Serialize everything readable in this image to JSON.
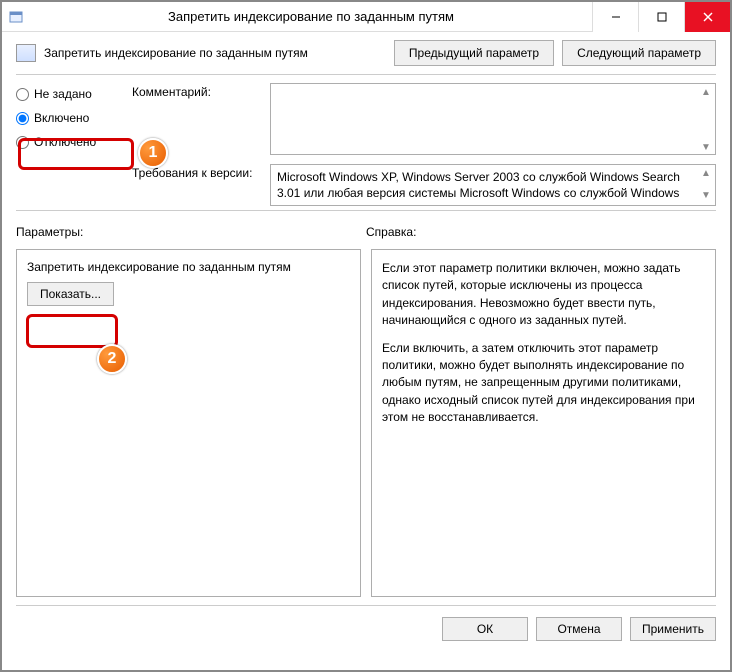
{
  "titlebar": {
    "title": "Запретить индексирование по заданным путям"
  },
  "header": {
    "title": "Запретить индексирование по заданным путям",
    "prev": "Предыдущий параметр",
    "next": "Следующий параметр"
  },
  "radios": {
    "not_configured": "Не задано",
    "enabled": "Включено",
    "disabled": "Отключено"
  },
  "comment": {
    "label": "Комментарий:",
    "value": ""
  },
  "requirements": {
    "label": "Требования к версии:",
    "text": "Microsoft Windows XP, Windows Server 2003 со службой Windows Search 3.01 или любая версия системы Microsoft Windows со службой Windows"
  },
  "sections": {
    "params": "Параметры:",
    "help": "Справка:"
  },
  "params": {
    "title": "Запретить индексирование по заданным путям",
    "show": "Показать..."
  },
  "help": {
    "p1": "Если этот параметр политики включен, можно задать список путей, которые исключены из процесса индексирования. Невозможно будет ввести путь, начинающийся с одного из заданных путей.",
    "p2": "Если включить, а затем отключить этот параметр политики, можно будет выполнять индексирование по любым путям, не запрещенным другими политиками, однако исходный список путей для индексирования при этом не восстанавливается."
  },
  "footer": {
    "ok": "ОК",
    "cancel": "Отмена",
    "apply": "Применить"
  },
  "annotations": {
    "n1": "1",
    "n2": "2"
  }
}
